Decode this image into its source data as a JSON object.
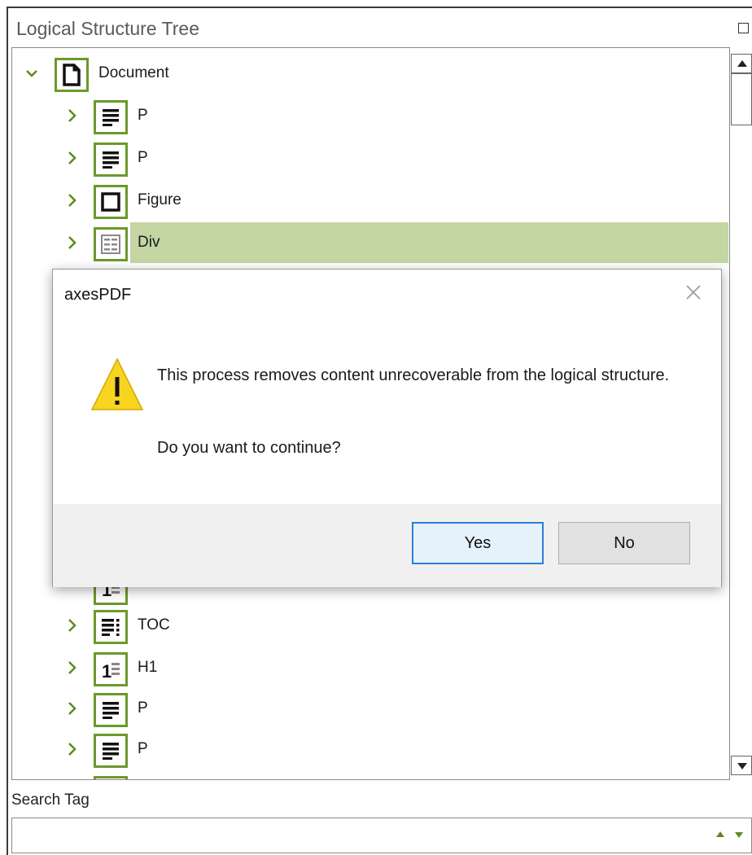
{
  "panel": {
    "title": "Logical Structure Tree"
  },
  "tree": {
    "items": [
      {
        "label": "Document",
        "icon": "document-icon",
        "expanded": true,
        "level": 0
      },
      {
        "label": "P",
        "icon": "paragraph-icon",
        "expanded": false,
        "level": 1
      },
      {
        "label": "P",
        "icon": "paragraph-icon",
        "expanded": false,
        "level": 1
      },
      {
        "label": "Figure",
        "icon": "figure-icon",
        "expanded": false,
        "level": 1
      },
      {
        "label": "Div",
        "icon": "div-icon",
        "expanded": false,
        "level": 1,
        "selected": true
      },
      {
        "label": "TOC",
        "icon": "toc-icon",
        "expanded": false,
        "level": 1
      },
      {
        "label": "H1",
        "icon": "heading-icon",
        "expanded": false,
        "level": 1
      },
      {
        "label": "P",
        "icon": "paragraph-icon",
        "expanded": false,
        "level": 1
      },
      {
        "label": "P",
        "icon": "paragraph-icon",
        "expanded": false,
        "level": 1
      }
    ]
  },
  "search": {
    "label": "Search Tag",
    "value": "",
    "placeholder": ""
  },
  "dialog": {
    "title": "axesPDF",
    "message": "This process removes content unrecoverable from the logical structure.",
    "question": "Do you want to continue?",
    "yes_label": "Yes",
    "no_label": "No",
    "icon": "warning-icon"
  },
  "colors": {
    "accent": "#6a9a2a",
    "selection": "#c3d6a3",
    "default_button_border": "#2b7fd4"
  }
}
